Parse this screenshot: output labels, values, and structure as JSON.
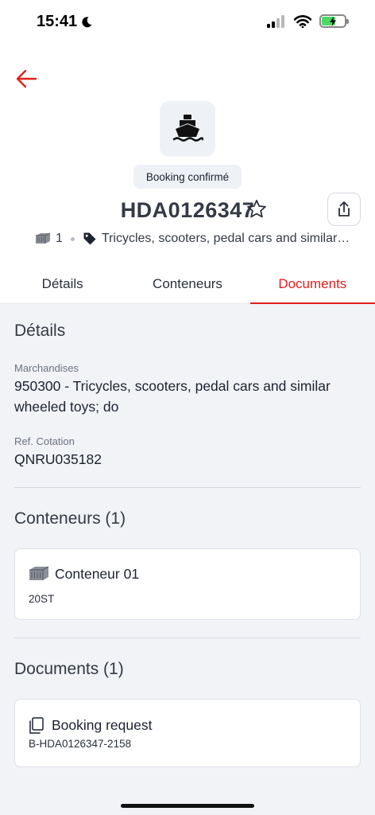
{
  "status_bar": {
    "time": "15:41"
  },
  "header": {
    "status_chip": "Booking confirmé",
    "booking_id": "HDA0126347",
    "package_count": "1",
    "goods_summary": "Tricycles, scooters, pedal cars and similar…"
  },
  "tabs": [
    {
      "label": "Détails",
      "active": false
    },
    {
      "label": "Conteneurs",
      "active": false
    },
    {
      "label": "Documents",
      "active": true
    }
  ],
  "details": {
    "title": "Détails",
    "goods_label": "Marchandises",
    "goods_value": "950300 - Tricycles, scooters, pedal cars and similar wheeled toys; do",
    "quote_label": "Ref. Cotation",
    "quote_value": "QNRU035182"
  },
  "containers": {
    "title": "Conteneurs (1)",
    "items": [
      {
        "name": "Conteneur 01",
        "type": "20ST"
      }
    ]
  },
  "documents": {
    "title": "Documents (1)",
    "items": [
      {
        "name": "Booking request",
        "reference": "B-HDA0126347-2158"
      }
    ]
  },
  "colors": {
    "accent": "#e0201c",
    "background": "#f1f3f7",
    "tile": "#eef1f6"
  }
}
